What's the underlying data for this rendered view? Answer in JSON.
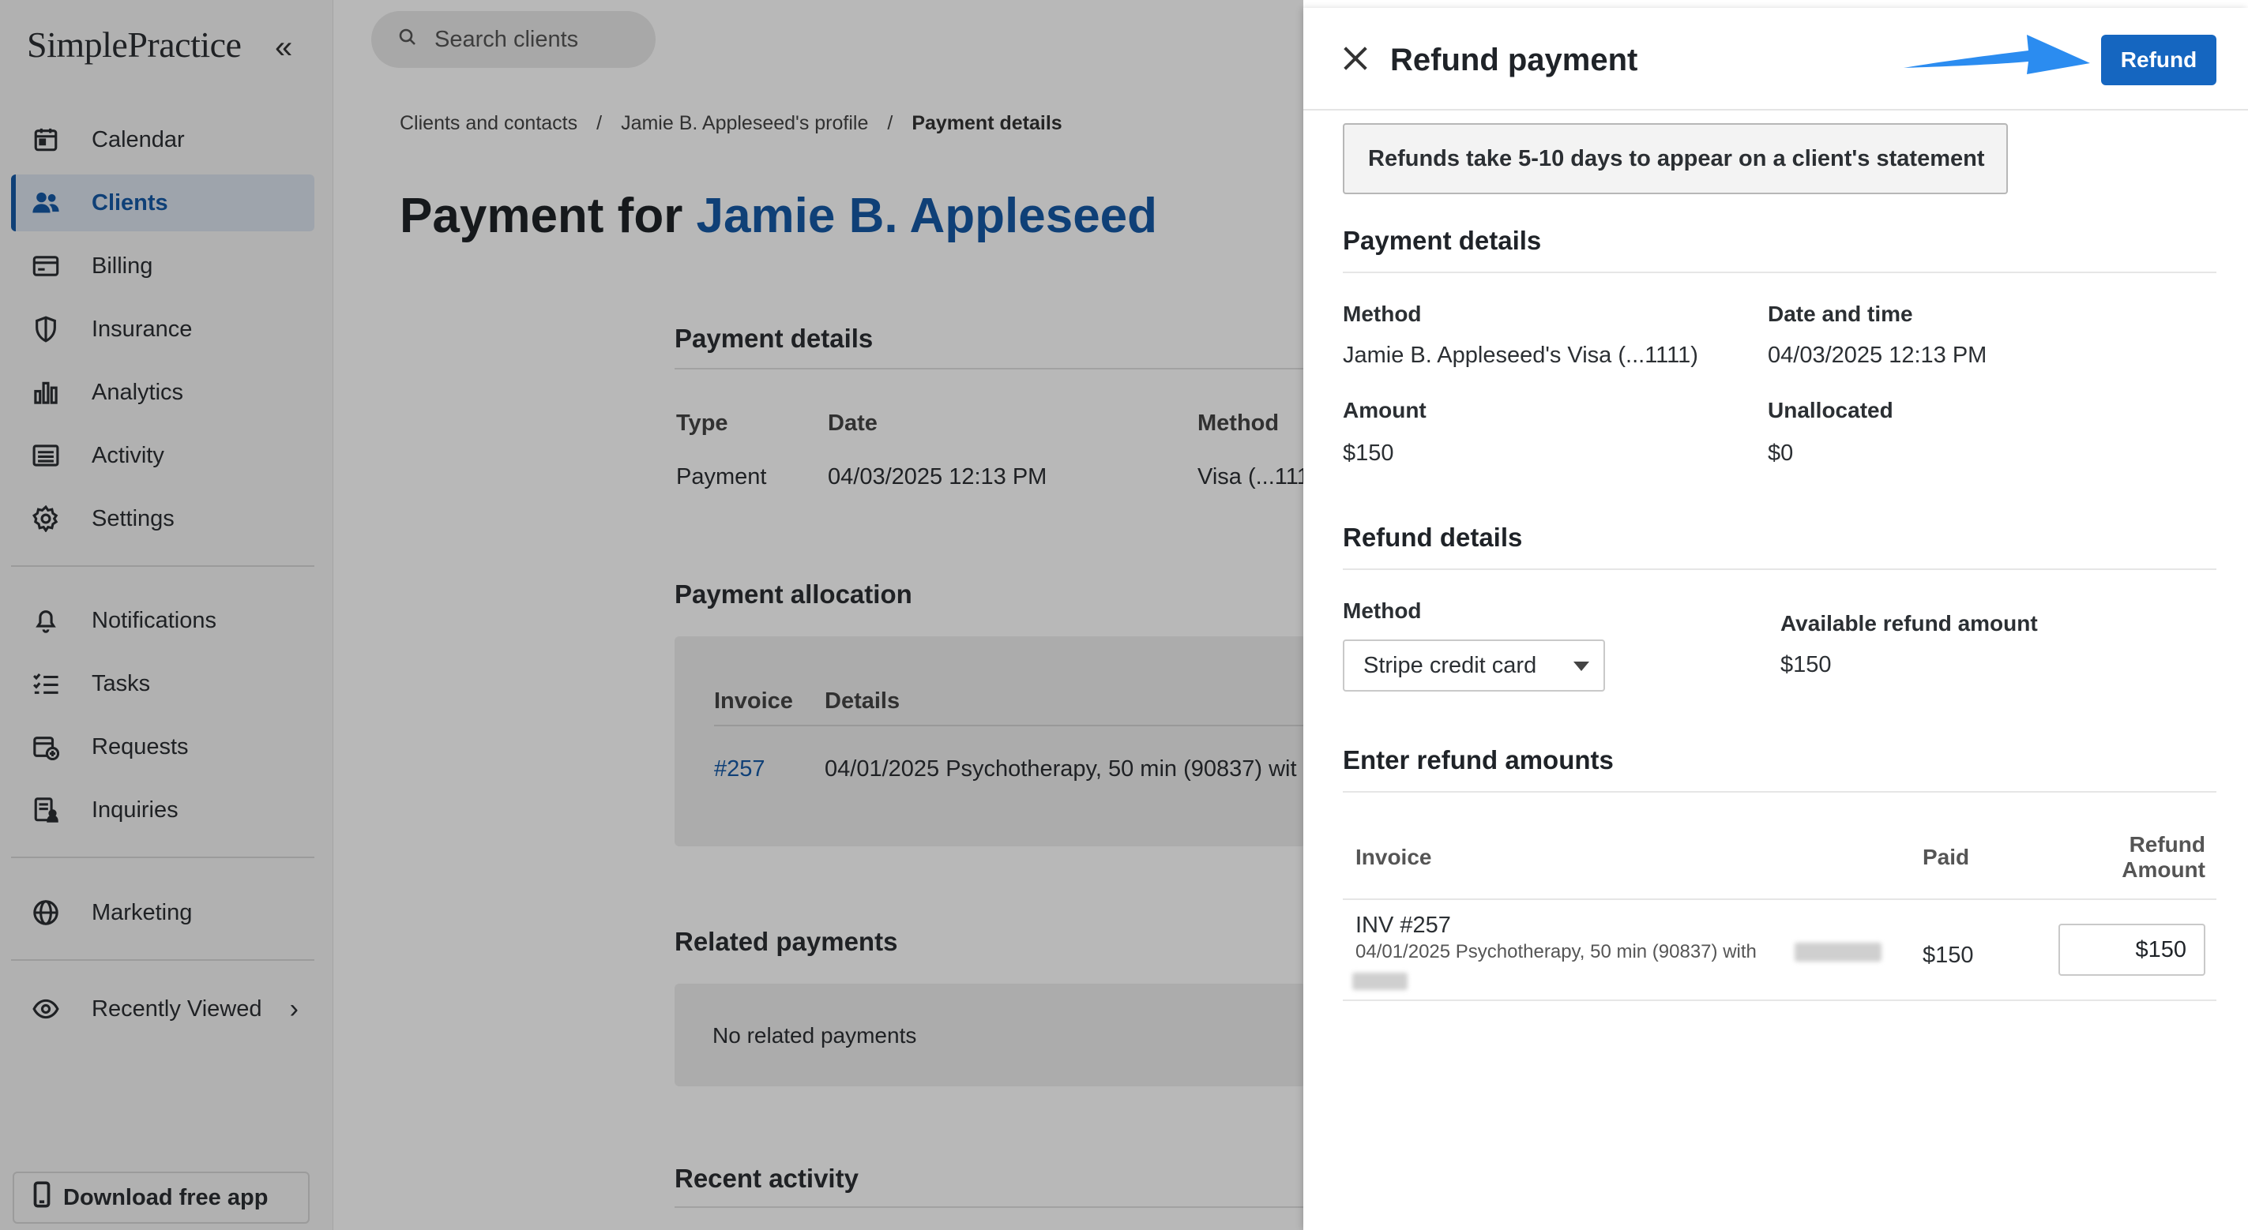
{
  "app": {
    "logo_text": "SimplePractice",
    "collapse_icon": "double-chevron-left-icon"
  },
  "sidebar": {
    "items": [
      {
        "label": "Calendar",
        "icon": "calendar-icon",
        "active": false
      },
      {
        "label": "Clients",
        "icon": "users-icon",
        "active": true
      },
      {
        "label": "Billing",
        "icon": "credit-card-icon",
        "active": false
      },
      {
        "label": "Insurance",
        "icon": "shield-icon",
        "active": false
      },
      {
        "label": "Analytics",
        "icon": "bar-chart-icon",
        "active": false
      },
      {
        "label": "Activity",
        "icon": "list-icon",
        "active": false
      },
      {
        "label": "Settings",
        "icon": "gear-icon",
        "active": false
      },
      {
        "label": "Notifications",
        "icon": "bell-icon",
        "active": false
      },
      {
        "label": "Tasks",
        "icon": "checklist-icon",
        "active": false
      },
      {
        "label": "Requests",
        "icon": "calendar-plus-icon",
        "active": false
      },
      {
        "label": "Inquiries",
        "icon": "document-person-icon",
        "active": false
      },
      {
        "label": "Marketing",
        "icon": "globe-icon",
        "active": false
      },
      {
        "label": "Recently Viewed",
        "icon": "eye-icon",
        "active": false
      }
    ],
    "download_label": "Download free app"
  },
  "search": {
    "placeholder": "Search clients"
  },
  "breadcrumb": [
    "Clients and contacts",
    "/",
    "Jamie B. Appleseed's profile",
    "/",
    "Payment details"
  ],
  "page": {
    "title_prefix": "Payment for ",
    "title_name": "Jamie B. Appleseed",
    "payment_details": {
      "heading": "Payment details",
      "columns": [
        "Type",
        "Date",
        "Method"
      ],
      "row": [
        "Payment",
        "04/03/2025 12:13 PM",
        "Visa (...111"
      ]
    },
    "allocation": {
      "heading": "Payment allocation",
      "columns": [
        "Invoice",
        "Details"
      ],
      "row": [
        "#257",
        "04/01/2025 Psychotherapy, 50 min (90837) wit"
      ]
    },
    "related": {
      "heading": "Related payments",
      "empty": "No related payments"
    },
    "recent": {
      "heading": "Recent activity"
    }
  },
  "panel": {
    "title": "Refund payment",
    "refund_button": "Refund",
    "notice": "Refunds take 5-10 days to appear on a client's statement",
    "payment_details": {
      "heading": "Payment details",
      "method_label": "Method",
      "method_value": "Jamie B. Appleseed's Visa (...1111)",
      "date_label": "Date and time",
      "date_value": "04/03/2025 12:13 PM",
      "amount_label": "Amount",
      "amount_value": "$150",
      "unallocated_label": "Unallocated",
      "unallocated_value": "$0"
    },
    "refund_details": {
      "heading": "Refund details",
      "method_label": "Method",
      "method_selected": "Stripe credit card",
      "available_label": "Available refund amount",
      "available_value": "$150"
    },
    "refund_amounts": {
      "heading": "Enter refund amounts",
      "col_invoice": "Invoice",
      "col_paid": "Paid",
      "col_refund_1": "Refund",
      "col_refund_2": "Amount",
      "row_invoice": "INV #257",
      "row_details": "04/01/2025 Psychotherapy, 50 min (90837) with",
      "row_paid": "$150",
      "row_refund": "$150"
    }
  },
  "colors": {
    "accent": "#1659a6",
    "button": "#1566c0",
    "arrow": "#2b8cf0"
  }
}
